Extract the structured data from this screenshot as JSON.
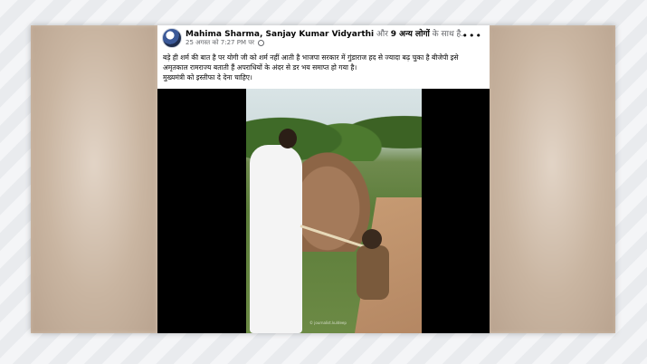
{
  "post": {
    "author_names": "Mahima Sharma, Sanjay Kumar Vidyarthi",
    "with_text": "और",
    "others_link": "9 अन्य लोगों",
    "with_suffix": "के साथ है.",
    "timestamp": "25 अगस्त को 7:27 PM पर",
    "more_menu": "•••",
    "text_line1": "बड़े ही शर्म की बात है पर योगी जी को शर्म नहीं आती है भाजपा सरकार में गुंडाराज हद से ज्यादा बढ़ चुका है बीजेपी इसे",
    "text_line2": "अमृतकाल रामराज्य बताती हैं अपराधियों के अंदर से डर भय समाप्त हो गया है।",
    "text_line3": "मुख्यमंत्री को इस्तीफा दे देना चाहिए।"
  },
  "icons": {
    "avatar": "profile-avatar",
    "privacy": "globe-icon",
    "more": "more-options-icon"
  },
  "video": {
    "watermark": "© journalist.kuldeep"
  }
}
